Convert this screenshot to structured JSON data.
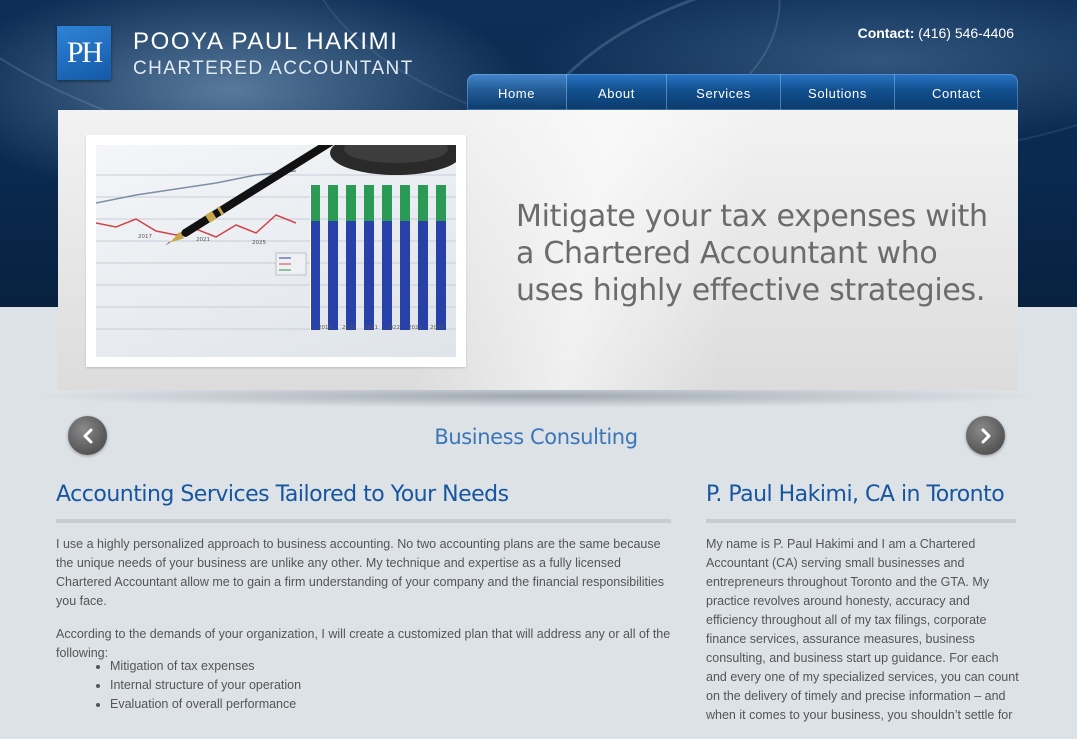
{
  "header": {
    "logo_monogram": "PH",
    "brand_name": "POOYA PAUL HAKIMI",
    "brand_subtitle": "CHARTERED ACCOUNTANT",
    "contact_label": "Contact:",
    "contact_phone": "(416) 546-4406"
  },
  "nav": {
    "items": [
      {
        "label": "Home",
        "active": true
      },
      {
        "label": "About",
        "active": false
      },
      {
        "label": "Services",
        "active": false
      },
      {
        "label": "Solutions",
        "active": false
      },
      {
        "label": "Contact",
        "active": false
      }
    ]
  },
  "banner": {
    "tagline": "Mitigate your tax expenses with a Chartered Accountant who uses highly effective strategies.",
    "photo_axis_labels": [
      "2017",
      "2021",
      "2025",
      "2019",
      "2020",
      "2021",
      "2022",
      "2023",
      "2024"
    ]
  },
  "slider": {
    "caption": "Business Consulting",
    "prev_icon": "chevron-left-icon",
    "next_icon": "chevron-right-icon"
  },
  "left_column": {
    "heading": "Accounting Services Tailored to Your Needs",
    "paragraphs": [
      "I use a highly personalized approach to business accounting. No two accounting plans are the same because the unique needs of your business are unlike any other. My technique and expertise as a fully licensed Chartered Accountant allow me to gain a firm understanding of your company and the financial responsibilities you face.",
      "According to the demands of your organization, I will create a customized plan that will address any or all of the following:"
    ],
    "bullets": [
      "Mitigation of tax expenses",
      "Internal structure of your operation",
      "Evaluation of overall performance"
    ]
  },
  "right_column": {
    "heading": "P. Paul Hakimi, CA in Toronto",
    "paragraph": "My name is P. Paul Hakimi and I am a Chartered Accountant (CA) serving small businesses and entrepreneurs throughout Toronto and the GTA. My practice revolves around honesty, accuracy and efficiency throughout all of my tax filings, corporate finance services, assurance measures, business consulting, and business start up guidance. For each and every one of my specialized services, you can count on the delivery of timely and precise information – and when it comes to your business, you shouldn’t settle for"
  },
  "colors": {
    "header_bg": "#0b2b52",
    "nav_blue": "#12508f",
    "heading_blue": "#16559f",
    "caption_blue": "#3b76b9",
    "page_bg": "#dde2e7"
  }
}
